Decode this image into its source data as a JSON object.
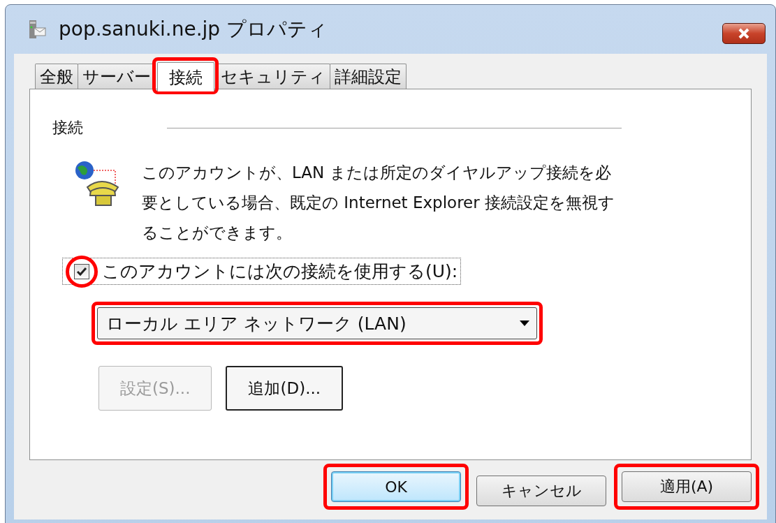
{
  "window": {
    "title": "pop.sanuki.ne.jp プロパティ"
  },
  "tabs": [
    {
      "label": "全般",
      "selected": false,
      "highlighted": false
    },
    {
      "label": "サーバー",
      "selected": false,
      "highlighted": false
    },
    {
      "label": "接続",
      "selected": true,
      "highlighted": true
    },
    {
      "label": "セキュリティ",
      "selected": false,
      "highlighted": false
    },
    {
      "label": "詳細設定",
      "selected": false,
      "highlighted": false
    }
  ],
  "group": {
    "label": "接続"
  },
  "description": "このアカウントが、LAN または所定のダイヤルアップ接続を必要としている場合、既定の Internet Explorer 接続設定を無視することができます。",
  "use_connection": {
    "label": "このアカウントには次の接続を使用する(U):",
    "checked": true,
    "highlighted": true
  },
  "connection_select": {
    "value": "ローカル エリア ネットワーク (LAN)",
    "highlighted": true
  },
  "connection_buttons": [
    {
      "label": "設定(S)...",
      "disabled": true
    },
    {
      "label": "追加(D)...",
      "disabled": false
    }
  ],
  "dialog_buttons": [
    {
      "label": "OK",
      "default": true,
      "highlighted": true
    },
    {
      "label": "キャンセル",
      "default": false,
      "highlighted": false
    },
    {
      "label": "適用(A)",
      "default": false,
      "highlighted": true
    }
  ]
}
